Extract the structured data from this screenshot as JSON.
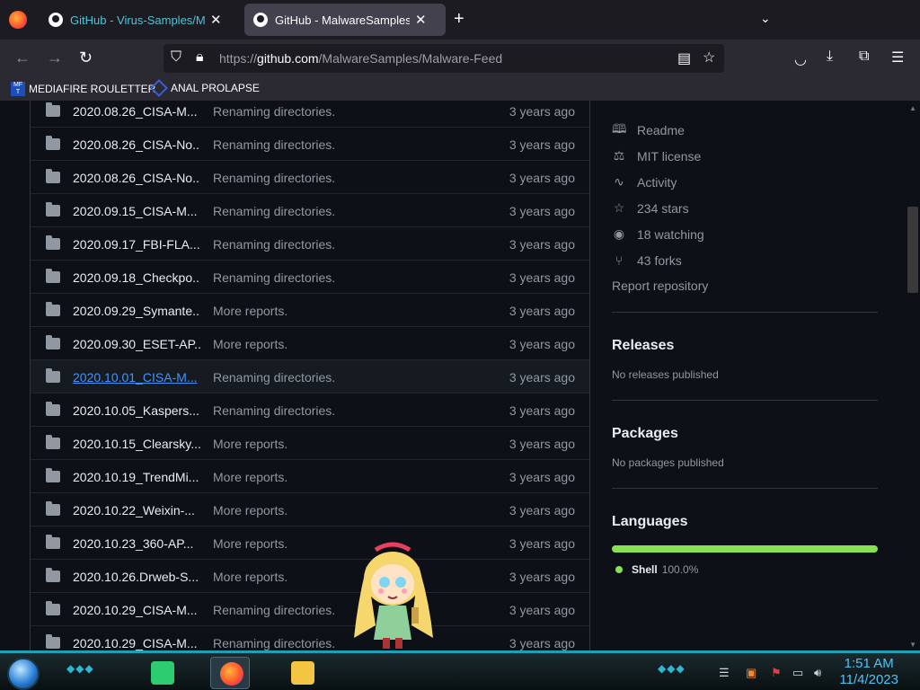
{
  "browser": {
    "tabs": [
      {
        "title": "GitHub - Virus-Samples/Malwa",
        "active": false
      },
      {
        "title": "GitHub - MalwareSamples/Mal",
        "active": true
      }
    ],
    "url_prefix": "https://",
    "url_host": "github.com",
    "url_path": "/MalwareSamples/Malware-Feed",
    "bookmarks": [
      {
        "label": "MEDIAFIRE ROULETTER",
        "icon": "MF T"
      },
      {
        "label": "ANAL PROLAPSE"
      }
    ]
  },
  "files": [
    {
      "name": "2020.08.26_CISA-M...",
      "message": "Renaming directories.",
      "age": "3 years ago"
    },
    {
      "name": "2020.08.26_CISA-No...",
      "message": "Renaming directories.",
      "age": "3 years ago"
    },
    {
      "name": "2020.08.26_CISA-No...",
      "message": "Renaming directories.",
      "age": "3 years ago"
    },
    {
      "name": "2020.09.15_CISA-M...",
      "message": "Renaming directories.",
      "age": "3 years ago"
    },
    {
      "name": "2020.09.17_FBI-FLA...",
      "message": "Renaming directories.",
      "age": "3 years ago"
    },
    {
      "name": "2020.09.18_Checkpo...",
      "message": "Renaming directories.",
      "age": "3 years ago"
    },
    {
      "name": "2020.09.29_Symante...",
      "message": "More reports.",
      "age": "3 years ago"
    },
    {
      "name": "2020.09.30_ESET-AP...",
      "message": "More reports.",
      "age": "3 years ago"
    },
    {
      "name": "2020.10.01_CISA-M...",
      "message": "Renaming directories.",
      "age": "3 years ago"
    },
    {
      "name": "2020.10.05_Kaspers...",
      "message": "Renaming directories.",
      "age": "3 years ago"
    },
    {
      "name": "2020.10.15_Clearsky...",
      "message": "More reports.",
      "age": "3 years ago"
    },
    {
      "name": "2020.10.19_TrendMi...",
      "message": "More reports.",
      "age": "3 years ago"
    },
    {
      "name": "2020.10.22_Weixin-...",
      "message": "More reports.",
      "age": "3 years ago"
    },
    {
      "name": "2020.10.23_360-AP...",
      "message": "More reports.",
      "age": "3 years ago"
    },
    {
      "name": "2020.10.26.Drweb-S...",
      "message": "More reports.",
      "age": "3 years ago"
    },
    {
      "name": "2020.10.29_CISA-M...",
      "message": "Renaming directories.",
      "age": "3 years ago"
    },
    {
      "name": "2020.10.29_CISA-M...",
      "message": "Renaming directories.",
      "age": "3 years ago"
    }
  ],
  "sidebar": {
    "items": [
      {
        "label": "Readme",
        "icon": "book-icon"
      },
      {
        "label": "MIT license",
        "icon": "scale-icon"
      },
      {
        "label": "Activity",
        "icon": "pulse-icon"
      },
      {
        "label": "234 stars",
        "icon": "star-icon"
      },
      {
        "label": "18 watching",
        "icon": "eye-icon"
      },
      {
        "label": "43 forks",
        "icon": "fork-icon"
      }
    ],
    "report": "Report repository",
    "releases_title": "Releases",
    "releases_sub": "No releases published",
    "packages_title": "Packages",
    "packages_sub": "No packages published",
    "languages_title": "Languages",
    "languages": [
      {
        "name": "Shell",
        "pct": "100.0%",
        "color": "#89e051"
      }
    ]
  },
  "taskbar": {
    "time": "1:51 AM",
    "date": "11/4/2023"
  }
}
